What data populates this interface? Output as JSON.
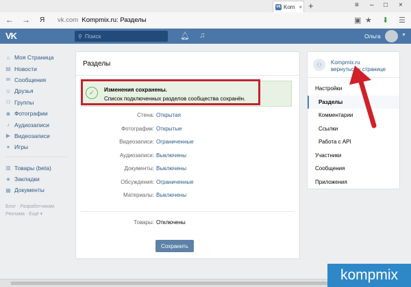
{
  "browser": {
    "tab_favicon": "vk",
    "tab_title": "Kom",
    "tab_close": "×",
    "new_tab": "+",
    "window_buttons": [
      "≡",
      "–",
      "□",
      "×"
    ],
    "nav": [
      "←",
      "→",
      "Я"
    ],
    "url_host": "vk.com",
    "url_title": "Kompmix.ru: Разделы",
    "icons": [
      "page-icon",
      "star-icon",
      "download-icon",
      "menu-icon"
    ]
  },
  "header": {
    "logo": "VK",
    "search_placeholder": "Поиск",
    "user_name": "Ольга"
  },
  "left_menu": {
    "main": [
      {
        "icon": "home-icon",
        "label": "Моя Страница"
      },
      {
        "icon": "news-icon",
        "label": "Новости"
      },
      {
        "icon": "messages-icon",
        "label": "Сообщения"
      },
      {
        "icon": "friends-icon",
        "label": "Друзья"
      },
      {
        "icon": "groups-icon",
        "label": "Группы"
      },
      {
        "icon": "photos-icon",
        "label": "Фотографии"
      },
      {
        "icon": "audio-icon",
        "label": "Аудиозаписи"
      },
      {
        "icon": "video-icon",
        "label": "Видеозаписи"
      },
      {
        "icon": "games-icon",
        "label": "Игры"
      }
    ],
    "extra": [
      {
        "icon": "goods-icon",
        "label": "Товары (beta)"
      },
      {
        "icon": "bookmarks-icon",
        "label": "Закладки"
      },
      {
        "icon": "documents-icon",
        "label": "Документы"
      }
    ],
    "footer_line1": "Блог · Разработчикам",
    "footer_line2": "Реклама · Ещё ▾"
  },
  "card": {
    "title": "Разделы",
    "notice_title": "Изменения сохранены.",
    "notice_text": "Список подключенных разделов сообщества сохранён.",
    "rows": [
      {
        "label": "Стена:",
        "value": "Открытая"
      },
      {
        "label": "Фотографии:",
        "value": "Открытые"
      },
      {
        "label": "Видеозаписи:",
        "value": "Ограниченные"
      },
      {
        "label": "Аудиозаписи:",
        "value": "Выключены"
      },
      {
        "label": "Документы:",
        "value": "Выключены"
      },
      {
        "label": "Обсуждения:",
        "value": "Ограниченные"
      },
      {
        "label": "Материалы:",
        "value": "Выключены"
      }
    ],
    "goods_label": "Товары:",
    "goods_value": "Отключены",
    "save_label": "Сохранить"
  },
  "right_panel": {
    "group_name": "Kompmix.ru",
    "back_link": "вернуться к странице",
    "menu": [
      {
        "label": "Настройки",
        "level": "top"
      },
      {
        "label": "Разделы",
        "level": "sub",
        "active": true
      },
      {
        "label": "Комментарии",
        "level": "sub"
      },
      {
        "label": "Ссылки",
        "level": "sub"
      },
      {
        "label": "Работа с API",
        "level": "sub"
      },
      {
        "label": "Участники",
        "level": "top"
      },
      {
        "label": "Сообщения",
        "level": "top"
      },
      {
        "label": "Приложения",
        "level": "top"
      }
    ]
  },
  "watermark": "kompmix",
  "colors": {
    "vk_blue": "#4a76a8",
    "link": "#2a5885",
    "success_bg": "#e8f2e4",
    "highlight_red": "#c3222e",
    "arrow_red": "#d0202a",
    "watermark_bg": "#2e88c8"
  }
}
